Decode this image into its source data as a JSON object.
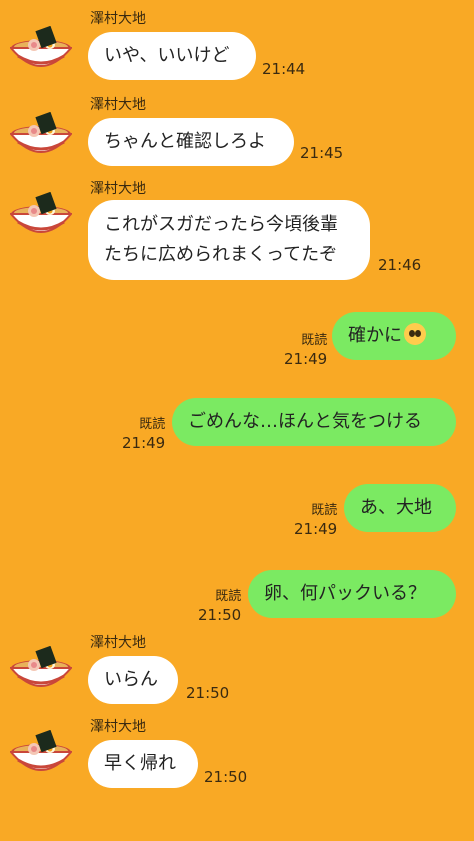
{
  "messages": [
    {
      "type": "in",
      "sender": "澤村大地",
      "text": "いや、いいけど",
      "time": "21:44"
    },
    {
      "type": "in",
      "sender": "澤村大地",
      "text": "ちゃんと確認しろよ",
      "time": "21:45"
    },
    {
      "type": "in",
      "sender": "澤村大地",
      "text_line1": "これがスガだったら今頃後輩",
      "text_line2": "たちに広められまくってたぞ",
      "time": "21:46"
    },
    {
      "type": "out",
      "read": "既読",
      "text": "確かに",
      "emoji": "pleading-face-emoji",
      "time": "21:49"
    },
    {
      "type": "out",
      "read": "既読",
      "text": "ごめんな…ほんと気をつける",
      "time": "21:49"
    },
    {
      "type": "out",
      "read": "既読",
      "text": "あ、大地",
      "time": "21:49"
    },
    {
      "type": "out",
      "read": "既読",
      "text": "卵、何パックいる？",
      "time": "21:50"
    },
    {
      "type": "in",
      "sender": "澤村大地",
      "text": "いらん",
      "time": "21:50"
    },
    {
      "type": "in",
      "sender": "澤村大地",
      "text": "早く帰れ",
      "time": "21:50"
    }
  ],
  "colors": {
    "background": "#F9A925",
    "incoming_bubble": "#FFFFFF",
    "outgoing_bubble": "#7BEA62"
  },
  "icons": {
    "avatar": "ramen-bowl-icon"
  }
}
